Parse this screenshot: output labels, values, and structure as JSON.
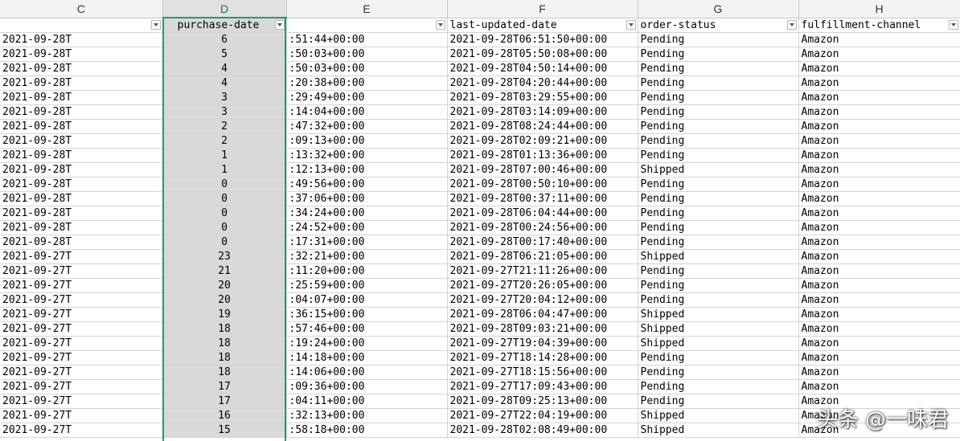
{
  "columns": {
    "letters": [
      "C",
      "D",
      "E",
      "F",
      "G",
      "H"
    ],
    "active_letter_index": 1
  },
  "headers": [
    "",
    "purchase-date",
    "",
    "last-updated-date",
    "order-status",
    "fulfillment-channel"
  ],
  "rows": [
    [
      "2021-09-28T",
      "6",
      ":51:44+00:00",
      "2021-09-28T06:51:50+00:00",
      "Pending",
      "Amazon"
    ],
    [
      "2021-09-28T",
      "5",
      ":50:03+00:00",
      "2021-09-28T05:50:08+00:00",
      "Pending",
      "Amazon"
    ],
    [
      "2021-09-28T",
      "4",
      ":50:03+00:00",
      "2021-09-28T04:50:14+00:00",
      "Pending",
      "Amazon"
    ],
    [
      "2021-09-28T",
      "4",
      ":20:38+00:00",
      "2021-09-28T04:20:44+00:00",
      "Pending",
      "Amazon"
    ],
    [
      "2021-09-28T",
      "3",
      ":29:49+00:00",
      "2021-09-28T03:29:55+00:00",
      "Pending",
      "Amazon"
    ],
    [
      "2021-09-28T",
      "3",
      ":14:04+00:00",
      "2021-09-28T03:14:09+00:00",
      "Pending",
      "Amazon"
    ],
    [
      "2021-09-28T",
      "2",
      ":47:32+00:00",
      "2021-09-28T08:24:44+00:00",
      "Pending",
      "Amazon"
    ],
    [
      "2021-09-28T",
      "2",
      ":09:13+00:00",
      "2021-09-28T02:09:21+00:00",
      "Pending",
      "Amazon"
    ],
    [
      "2021-09-28T",
      "1",
      ":13:32+00:00",
      "2021-09-28T01:13:36+00:00",
      "Pending",
      "Amazon"
    ],
    [
      "2021-09-28T",
      "1",
      ":12:13+00:00",
      "2021-09-28T07:00:46+00:00",
      "Shipped",
      "Amazon"
    ],
    [
      "2021-09-28T",
      "0",
      ":49:56+00:00",
      "2021-09-28T00:50:10+00:00",
      "Pending",
      "Amazon"
    ],
    [
      "2021-09-28T",
      "0",
      ":37:06+00:00",
      "2021-09-28T00:37:11+00:00",
      "Pending",
      "Amazon"
    ],
    [
      "2021-09-28T",
      "0",
      ":34:24+00:00",
      "2021-09-28T06:04:44+00:00",
      "Pending",
      "Amazon"
    ],
    [
      "2021-09-28T",
      "0",
      ":24:52+00:00",
      "2021-09-28T00:24:56+00:00",
      "Pending",
      "Amazon"
    ],
    [
      "2021-09-28T",
      "0",
      ":17:31+00:00",
      "2021-09-28T00:17:40+00:00",
      "Pending",
      "Amazon"
    ],
    [
      "2021-09-27T",
      "23",
      ":32:21+00:00",
      "2021-09-28T06:21:05+00:00",
      "Shipped",
      "Amazon"
    ],
    [
      "2021-09-27T",
      "21",
      ":11:20+00:00",
      "2021-09-27T21:11:26+00:00",
      "Pending",
      "Amazon"
    ],
    [
      "2021-09-27T",
      "20",
      ":25:59+00:00",
      "2021-09-27T20:26:05+00:00",
      "Pending",
      "Amazon"
    ],
    [
      "2021-09-27T",
      "20",
      ":04:07+00:00",
      "2021-09-27T20:04:12+00:00",
      "Pending",
      "Amazon"
    ],
    [
      "2021-09-27T",
      "19",
      ":36:15+00:00",
      "2021-09-28T06:04:47+00:00",
      "Shipped",
      "Amazon"
    ],
    [
      "2021-09-27T",
      "18",
      ":57:46+00:00",
      "2021-09-28T09:03:21+00:00",
      "Shipped",
      "Amazon"
    ],
    [
      "2021-09-27T",
      "18",
      ":19:24+00:00",
      "2021-09-27T19:04:39+00:00",
      "Shipped",
      "Amazon"
    ],
    [
      "2021-09-27T",
      "18",
      ":14:18+00:00",
      "2021-09-27T18:14:28+00:00",
      "Pending",
      "Amazon"
    ],
    [
      "2021-09-27T",
      "18",
      ":14:06+00:00",
      "2021-09-27T18:15:56+00:00",
      "Pending",
      "Amazon"
    ],
    [
      "2021-09-27T",
      "17",
      ":09:36+00:00",
      "2021-09-27T17:09:43+00:00",
      "Pending",
      "Amazon"
    ],
    [
      "2021-09-27T",
      "17",
      ":04:11+00:00",
      "2021-09-28T09:25:13+00:00",
      "Pending",
      "Amazon"
    ],
    [
      "2021-09-27T",
      "16",
      ":32:13+00:00",
      "2021-09-27T22:04:19+00:00",
      "Shipped",
      "Amazon"
    ],
    [
      "2021-09-27T",
      "15",
      ":58:18+00:00",
      "2021-09-28T02:08:49+00:00",
      "Shipped",
      "Amazon"
    ]
  ],
  "watermark": "头条 @一味君",
  "colors": {
    "selection_border": "#1e9e66",
    "selected_column_fill": "#d9d9d9",
    "header_fill": "#f3f3f3"
  }
}
